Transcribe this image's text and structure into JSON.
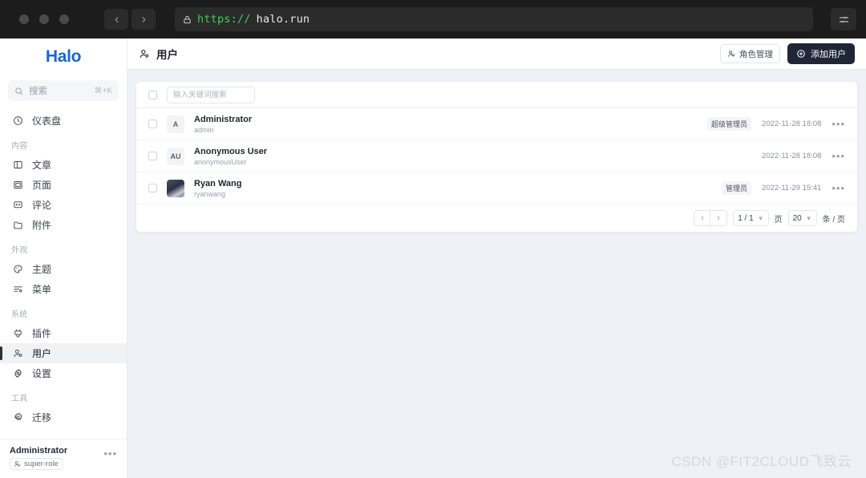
{
  "browser": {
    "back_icon": "chevron-left-icon",
    "forward_icon": "chevron-right-icon",
    "lock_icon": "lock-icon",
    "url_scheme": "https://",
    "url_host": "halo.run",
    "menu_icon": "sliders-icon"
  },
  "sidebar": {
    "logo": "Halo",
    "search": {
      "placeholder": "搜索",
      "shortcut": "⌘+K",
      "icon": "search-icon"
    },
    "groups": [
      {
        "label": "",
        "items": [
          {
            "label": "仪表盘",
            "icon": "dashboard-icon",
            "active": false
          }
        ]
      },
      {
        "label": "内容",
        "items": [
          {
            "label": "文章",
            "icon": "post-icon",
            "active": false
          },
          {
            "label": "页面",
            "icon": "page-icon",
            "active": false
          },
          {
            "label": "评论",
            "icon": "comment-icon",
            "active": false
          },
          {
            "label": "附件",
            "icon": "attachment-icon",
            "active": false
          }
        ]
      },
      {
        "label": "外观",
        "items": [
          {
            "label": "主题",
            "icon": "theme-icon",
            "active": false
          },
          {
            "label": "菜单",
            "icon": "menu-icon",
            "active": false
          }
        ]
      },
      {
        "label": "系统",
        "items": [
          {
            "label": "插件",
            "icon": "plugin-icon",
            "active": false
          },
          {
            "label": "用户",
            "icon": "user-icon",
            "active": true
          },
          {
            "label": "设置",
            "icon": "settings-icon",
            "active": false
          }
        ]
      },
      {
        "label": "工具",
        "items": [
          {
            "label": "迁移",
            "icon": "migrate-icon",
            "active": false
          }
        ]
      }
    ],
    "footer": {
      "name": "Administrator",
      "role": "super-role",
      "role_icon": "user-icon",
      "more_icon": "ellipsis-icon"
    }
  },
  "header": {
    "title": "用户",
    "title_icon": "user-icon",
    "role_button": {
      "label": "角色管理",
      "icon": "user-icon"
    },
    "add_button": {
      "label": "添加用户",
      "icon": "plus-circle-icon"
    }
  },
  "table": {
    "search_placeholder": "输入关键词搜索",
    "select_all_checkbox": "unchecked",
    "rows": [
      {
        "avatar_text": "A",
        "avatar_type": "initials",
        "name": "Administrator",
        "handle": "admin",
        "badge": "超级管理员",
        "timestamp": "2022-11-28 18:08",
        "more_icon": "ellipsis-icon"
      },
      {
        "avatar_text": "AU",
        "avatar_type": "initials",
        "name": "Anonymous User",
        "handle": "anonymousUser",
        "badge": "",
        "timestamp": "2022-11-28 18:08",
        "more_icon": "ellipsis-icon"
      },
      {
        "avatar_text": "",
        "avatar_type": "photo",
        "name": "Ryan Wang",
        "handle": "ryanwang",
        "badge": "管理员",
        "timestamp": "2022-11-29 15:41",
        "more_icon": "ellipsis-icon"
      }
    ]
  },
  "pagination": {
    "prev_icon": "chevron-left-icon",
    "next_icon": "chevron-right-icon",
    "page_value": "1 / 1",
    "page_unit": "页",
    "size_value": "20",
    "size_unit": "条 / 页"
  },
  "watermark": "CSDN @FIT2CLOUD飞致云",
  "colors": {
    "brand": "#1766d6",
    "primary_button": "#1f2638",
    "page_bg": "#eef1f5",
    "url_scheme": "#3ecf5a"
  }
}
